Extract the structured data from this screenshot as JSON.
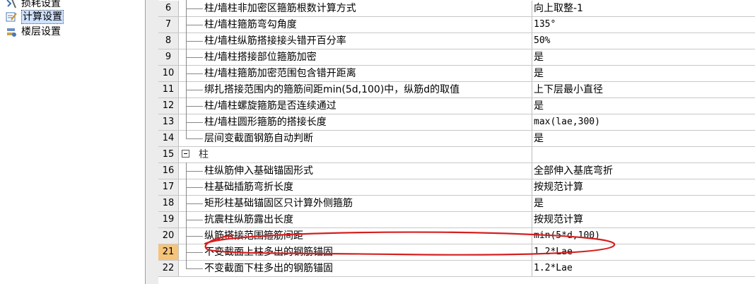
{
  "tree": {
    "items": [
      {
        "label": "损耗设置",
        "icon": "loss-settings-icon",
        "selected": false
      },
      {
        "label": "计算设置",
        "icon": "calc-settings-icon",
        "selected": true
      },
      {
        "label": "楼层设置",
        "icon": "floor-settings-icon",
        "selected": false
      }
    ]
  },
  "grid": {
    "rows": [
      {
        "num": "6",
        "name": "柱/墙柱非加密区箍筋根数计算方式",
        "value": "向上取整-1"
      },
      {
        "num": "7",
        "name": "柱/墙柱箍筋弯勾角度",
        "value": "135°"
      },
      {
        "num": "8",
        "name": "柱/墙柱纵筋搭接接头错开百分率",
        "value": "50%"
      },
      {
        "num": "9",
        "name": "柱/墙柱搭接部位箍筋加密",
        "value": "是"
      },
      {
        "num": "10",
        "name": "柱/墙柱箍筋加密范围包含错开距离",
        "value": "是"
      },
      {
        "num": "11",
        "name": "绑扎搭接范围内的箍筋间距min(5d,100)中，纵筋d的取值",
        "value": "上下层最小直径"
      },
      {
        "num": "12",
        "name": "柱/墙柱螺旋箍筋是否连续通过",
        "value": "是"
      },
      {
        "num": "13",
        "name": "柱/墙柱圆形箍筋的搭接长度",
        "value": "max(lae,300)"
      },
      {
        "num": "14",
        "name": "层间变截面钢筋自动判断",
        "value": "是"
      },
      {
        "num": "15",
        "name": "柱",
        "value": "",
        "group": true
      },
      {
        "num": "16",
        "name": "柱纵筋伸入基础锚固形式",
        "value": "全部伸入基底弯折"
      },
      {
        "num": "17",
        "name": "柱基础插筋弯折长度",
        "value": "按规范计算"
      },
      {
        "num": "18",
        "name": "矩形柱基础锚固区只计算外侧箍筋",
        "value": "是"
      },
      {
        "num": "19",
        "name": "抗震柱纵筋露出长度",
        "value": "按规范计算"
      },
      {
        "num": "20",
        "name": "纵筋搭接范围箍筋间距",
        "value": "min(5*d,100)"
      },
      {
        "num": "21",
        "name": "不变截面上柱多出的钢筋锚固",
        "value": "1.2*Lae",
        "highlight": true
      },
      {
        "num": "22",
        "name": "不变截面下柱多出的钢筋锚固",
        "value": "1.2*Lae"
      }
    ]
  },
  "colors": {
    "annotation": "#d42020",
    "row_highlight": "#f5c37a",
    "header_bg": "#ececec"
  }
}
